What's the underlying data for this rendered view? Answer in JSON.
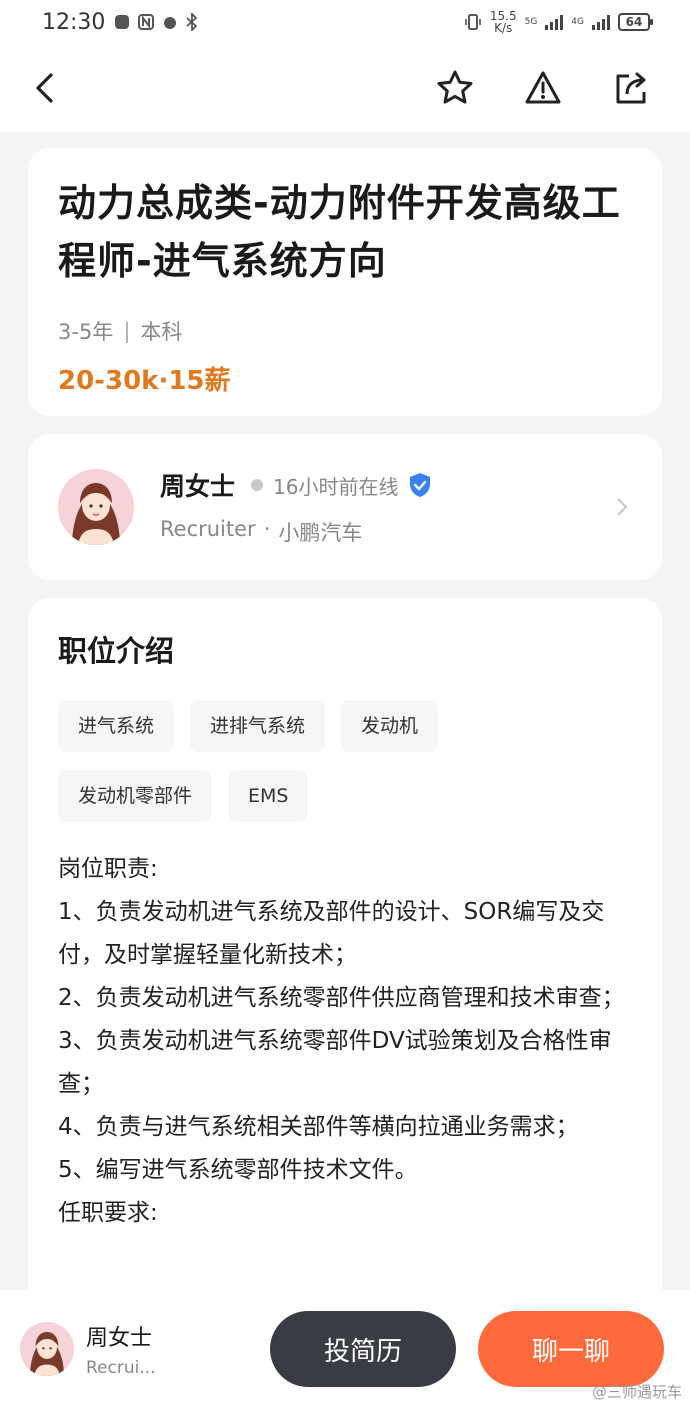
{
  "status_bar": {
    "time": "12:30",
    "net_speed_value": "15.5",
    "net_speed_unit": "K/s",
    "signal1_label": "5G",
    "signal2_label": "4G",
    "battery": "64"
  },
  "nav": {
    "back_icon": "chevron-left-icon",
    "favorite_icon": "star-icon",
    "report_icon": "warning-icon",
    "share_icon": "share-icon"
  },
  "job": {
    "title": "动力总成类-动力附件开发高级工程师-进气系统方向",
    "experience": "3-5年",
    "separator": "|",
    "education": "本科",
    "salary": "20-30k·15薪"
  },
  "recruiter": {
    "name": "周女士",
    "online_status": "16小时前在线",
    "role": "Recruiter",
    "dot": "·",
    "company": "小鹏汽车"
  },
  "description": {
    "section_title": "职位介绍",
    "tags": [
      "进气系统",
      "进排气系统",
      "发动机",
      "发动机零部件",
      "EMS"
    ],
    "lines": [
      "岗位职责:",
      "1、负责发动机进气系统及部件的设计、SOR编写及交付，及时掌握轻量化新技术；",
      "2、负责发动机进气系统零部件供应商管理和技术审查；",
      "3、负责发动机进气系统零部件DV试验策划及合格性审查；",
      "4、负责与进气系统相关部件等横向拉通业务需求；",
      "5、编写进气系统零部件技术文件。",
      "任职要求:"
    ]
  },
  "bottom_bar": {
    "name": "周女士",
    "role": "Recrui...",
    "resume_button": "投简历",
    "chat_button": "聊一聊"
  },
  "watermark": "@三师遇玩车",
  "colors": {
    "salary": "#e07a1f",
    "chat_button": "#ff6a3d",
    "resume_button": "#3a3c44",
    "verified": "#3b7ff5"
  }
}
